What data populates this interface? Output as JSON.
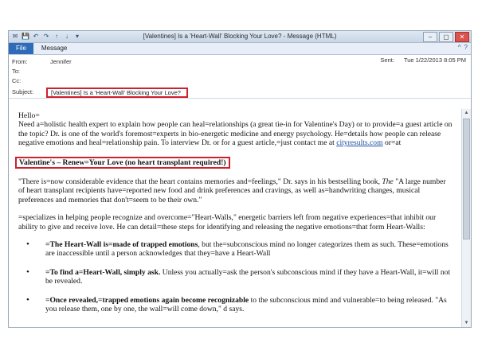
{
  "window": {
    "title": "[Valentines] Is a 'Heart-Wall' Blocking Your Love? - Message (HTML)",
    "quick_access": [
      "✉",
      "💾",
      "↶",
      "↷",
      "↑",
      "↓",
      "▾"
    ],
    "controls": [
      "–",
      "▢",
      "✕"
    ]
  },
  "ribbon": {
    "file_label": "File",
    "message_label": "Message",
    "right_icons": [
      "^",
      "?"
    ]
  },
  "header": {
    "from_label": "From:",
    "from_value": "Jennifer",
    "to_label": "To:",
    "cc_label": "Cc:",
    "subject_label": "Subject:",
    "subject_value": "[Valentines] Is a 'Heart-Wall' Blocking Your Love?",
    "sent_label": "Sent:",
    "sent_value": "Tue 1/22/2013 8:05 PM"
  },
  "body": {
    "greeting": "Hello=",
    "intro": "Need a=holistic health expert to explain how people can heal=relationships (a great tie-in for Valentine's Day) or to provide=a guest article on the topic? Dr. is one of the world's foremost=experts in bio-energetic medicine and energy psychology. He=details how people can release negative emotions and heal=relationship pain. To interview Dr. or for a guest article,=just contact me at",
    "link_text": "cityresults.com",
    "intro_tail": " or=at",
    "headline": "Valentine's – Renew=Your Love (no heart transplant required!)",
    "quote_part1": "\"There is=now considerable evidence that the heart contains memories and=feelings,\" Dr. says in his bestselling book, ",
    "book_title": "The",
    "quote_part2": "\"A large number of heart transplant recipients have=reported new food and drink preferences and cravings, as well as=handwriting changes, musical preferences and memories that don't=seem to be their own.\"",
    "specializes": "=specializes in helping people recognize and overcome=\"Heart-Walls,\" energetic barriers left from negative experiences=that inhibit our ability to give and receive love. He can detail=these steps for identifying and releasing the negative emotions=that form Heart-Walls:",
    "bullet1_bold": "=The Heart-Wall is=made of trapped emotions",
    "bullet1_rest": ", but the=subconscious mind no longer categorizes them as such. These=emotions are inaccessible until a person acknowledges that they=have a Heart-Wall",
    "bullet2_bold": "=To find a=Heart-Wall, simply ask.",
    "bullet2_rest": " Unless you actually=ask the person's subconscious mind if they have a Heart-Wall, it=will not be revealed.",
    "bullet3_bold": "=Once revealed,=trapped emotions again become recognizable",
    "bullet3_rest": " to the subconscious mind and vulnerable=to being released. \"As you release them, one by one, the wall=will come down,\" d says."
  },
  "colors": {
    "highlight_box": "#d01f2e",
    "file_tab": "#2e6bb8",
    "link": "#1a4fa3"
  }
}
